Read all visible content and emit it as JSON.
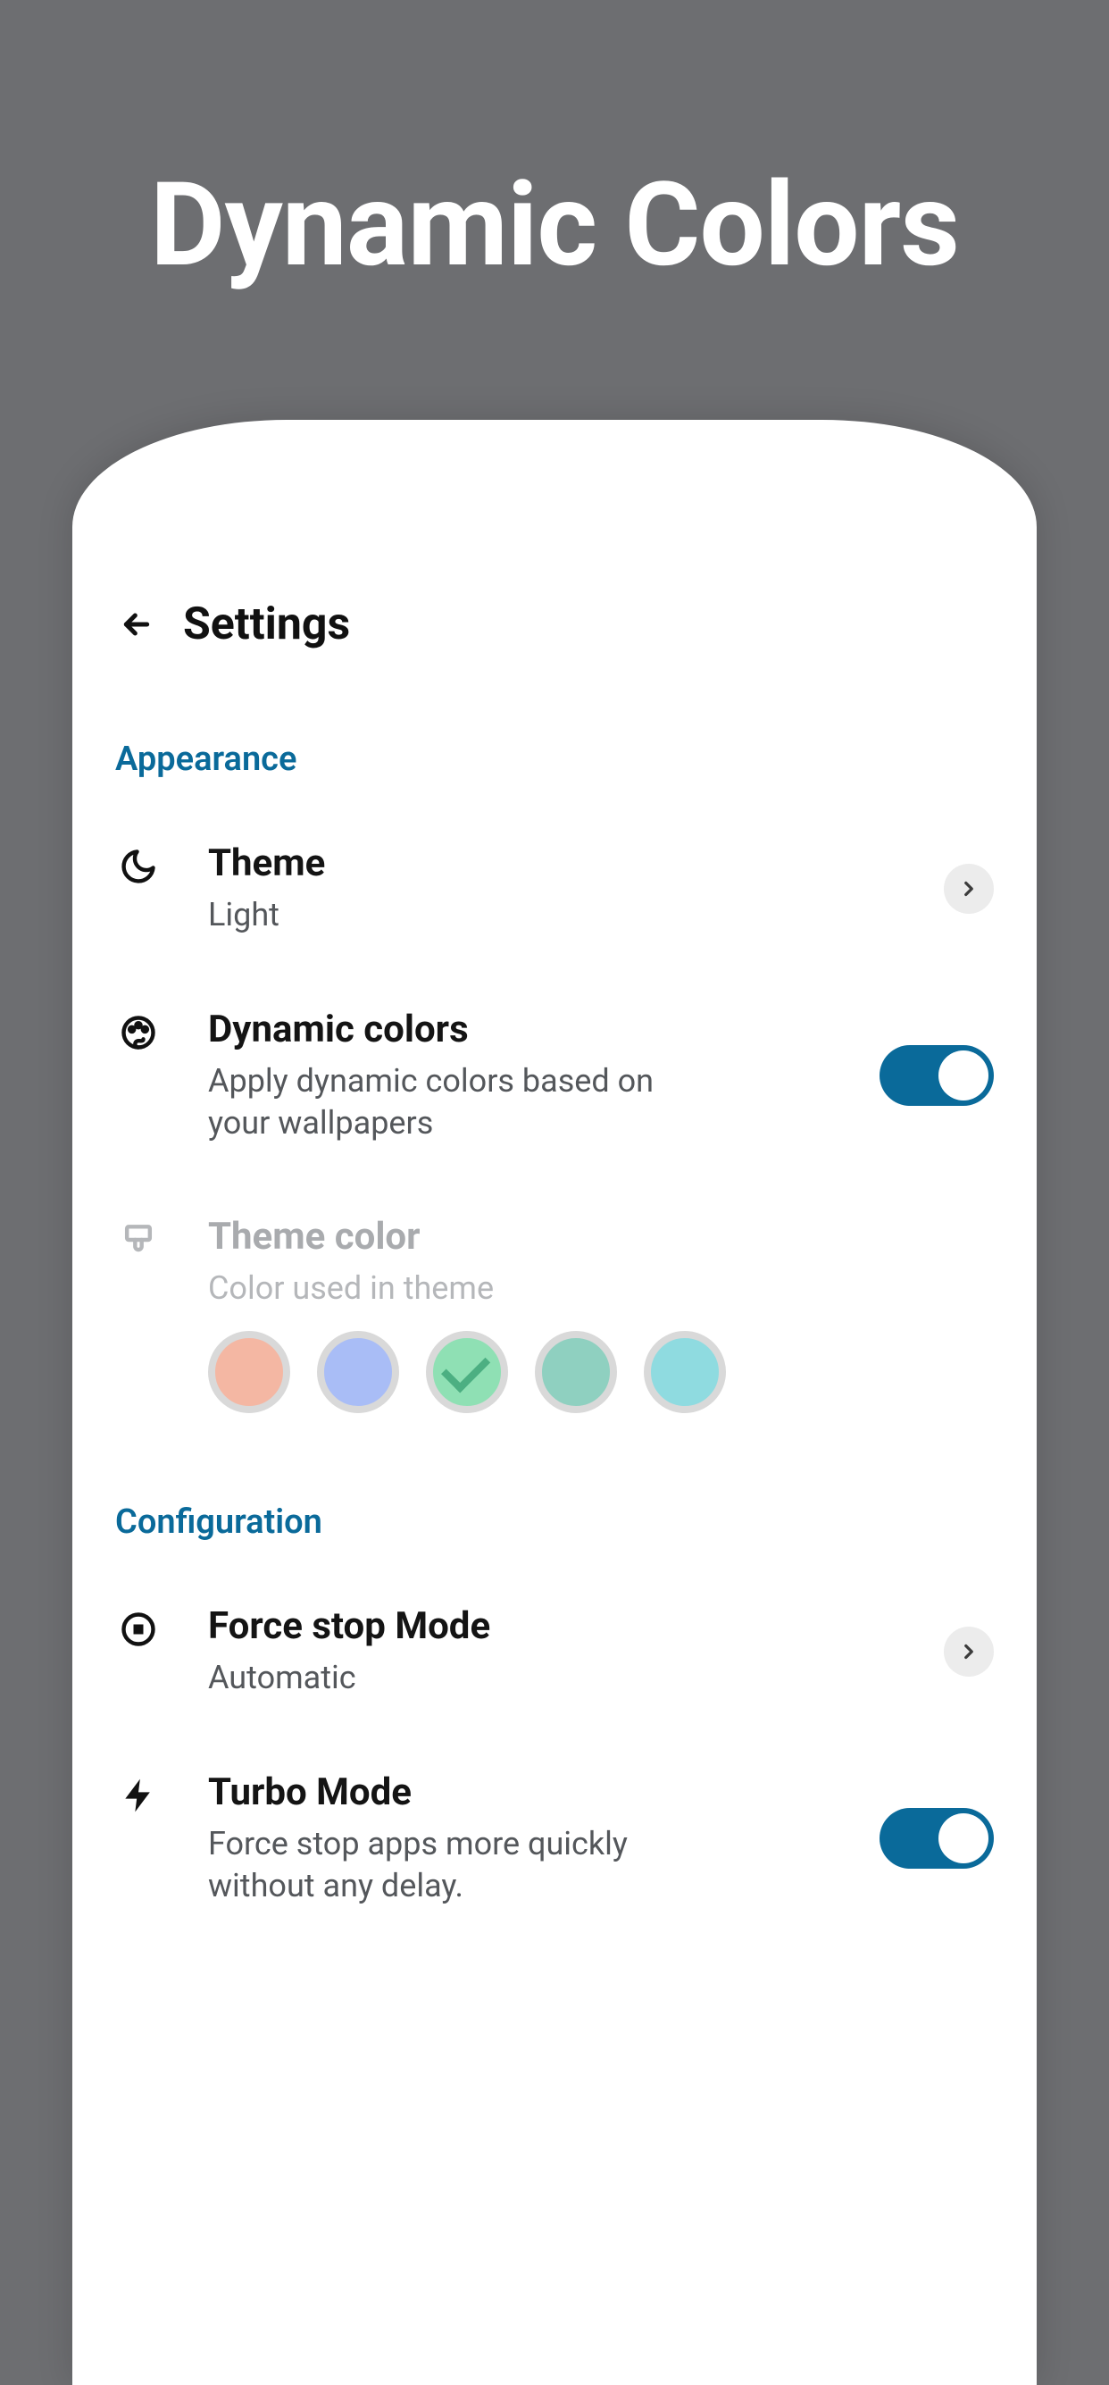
{
  "hero": {
    "title": "Dynamic Colors"
  },
  "appbar": {
    "title": "Settings"
  },
  "sections": {
    "appearance": {
      "label": "Appearance"
    },
    "configuration": {
      "label": "Configuration"
    }
  },
  "rows": {
    "theme": {
      "title": "Theme",
      "subtitle": "Light"
    },
    "dynamic": {
      "title": "Dynamic colors",
      "subtitle": "Apply dynamic colors based on your wallpapers",
      "enabled": true
    },
    "themeColor": {
      "title": "Theme color",
      "subtitle": "Color used in theme"
    },
    "forceStop": {
      "title": "Force stop Mode",
      "subtitle": "Automatic"
    },
    "turbo": {
      "title": "Turbo Mode",
      "subtitle": "Force stop apps more quickly without any delay.",
      "enabled": true
    }
  },
  "swatches": [
    {
      "color": "#f4b7a3",
      "selected": false
    },
    {
      "color": "#a9bdf6",
      "selected": false
    },
    {
      "color": "#8fe0b4",
      "selected": true
    },
    {
      "color": "#8fd0c0",
      "selected": false
    },
    {
      "color": "#8fdbe0",
      "selected": false
    }
  ],
  "colors": {
    "accent": "#0a6a9a"
  }
}
